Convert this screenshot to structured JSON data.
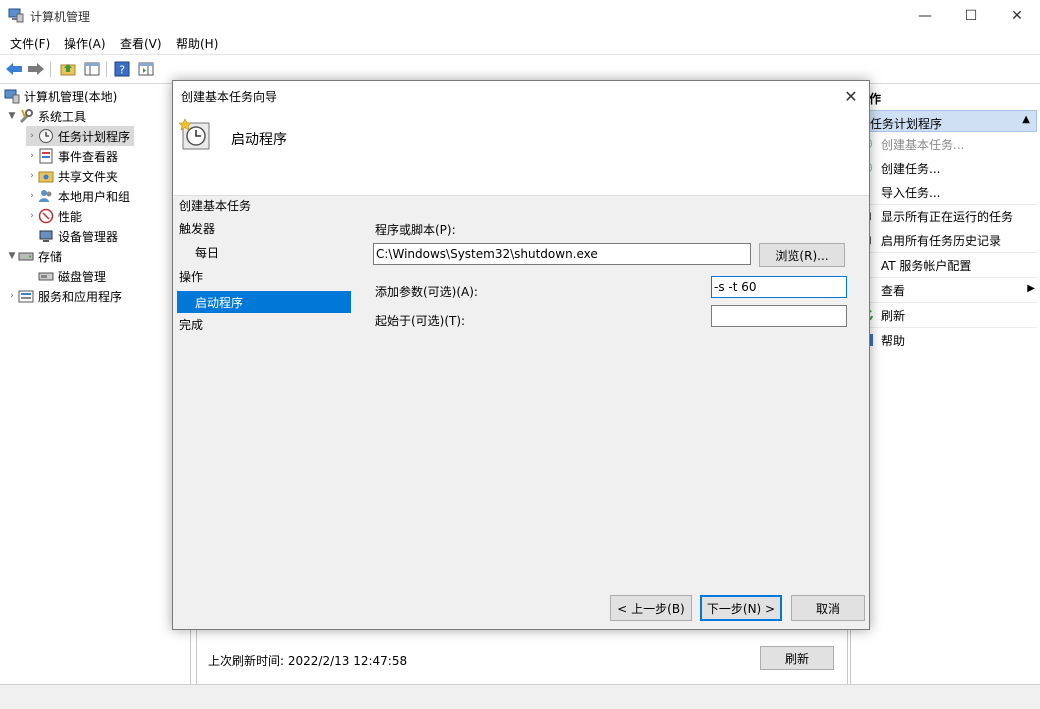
{
  "window": {
    "title": "计算机管理",
    "menu": [
      "文件(F)",
      "操作(A)",
      "查看(V)",
      "帮助(H)"
    ]
  },
  "tree": {
    "root": "计算机管理(本地)",
    "system_tools": "系统工具",
    "task_scheduler": "任务计划程序",
    "event_viewer": "事件查看器",
    "shared_folders": "共享文件夹",
    "local_users": "本地用户和组",
    "performance": "性能",
    "device_manager": "设备管理器",
    "storage": "存储",
    "disk_management": "磁盘管理",
    "services_apps": "服务和应用程序"
  },
  "middle": {
    "last_refresh": "上次刷新时间: 2022/2/13 12:47:58",
    "refresh_button": "刷新"
  },
  "actions": {
    "header": "作",
    "section": "任务计划程序",
    "items": [
      "创建基本任务...",
      "创建任务...",
      "导入任务...",
      "显示所有正在运行的任务",
      "启用所有任务历史记录",
      "AT 服务帐户配置",
      "查看",
      "刷新",
      "帮助"
    ]
  },
  "dialog": {
    "title": "创建基本任务向导",
    "heading": "启动程序",
    "steps": {
      "title": "创建基本任务",
      "trigger": "触发器",
      "daily": "每日",
      "action": "操作",
      "start_program": "启动程序",
      "finish": "完成"
    },
    "program_label": "程序或脚本(P):",
    "program_value": "C:\\Windows\\System32\\shutdown.exe",
    "browse_button": "浏览(R)...",
    "args_label": "添加参数(可选)(A):",
    "args_value": "-s -t 60",
    "startin_label": "起始于(可选)(T):",
    "startin_value": "",
    "back_button": "< 上一步(B)",
    "next_button": "下一步(N) >",
    "cancel_button": "取消"
  },
  "colors": {
    "selection": "#0078d7",
    "action_section": "#cfe0f4",
    "dialog_bg": "#f0f0f0"
  }
}
